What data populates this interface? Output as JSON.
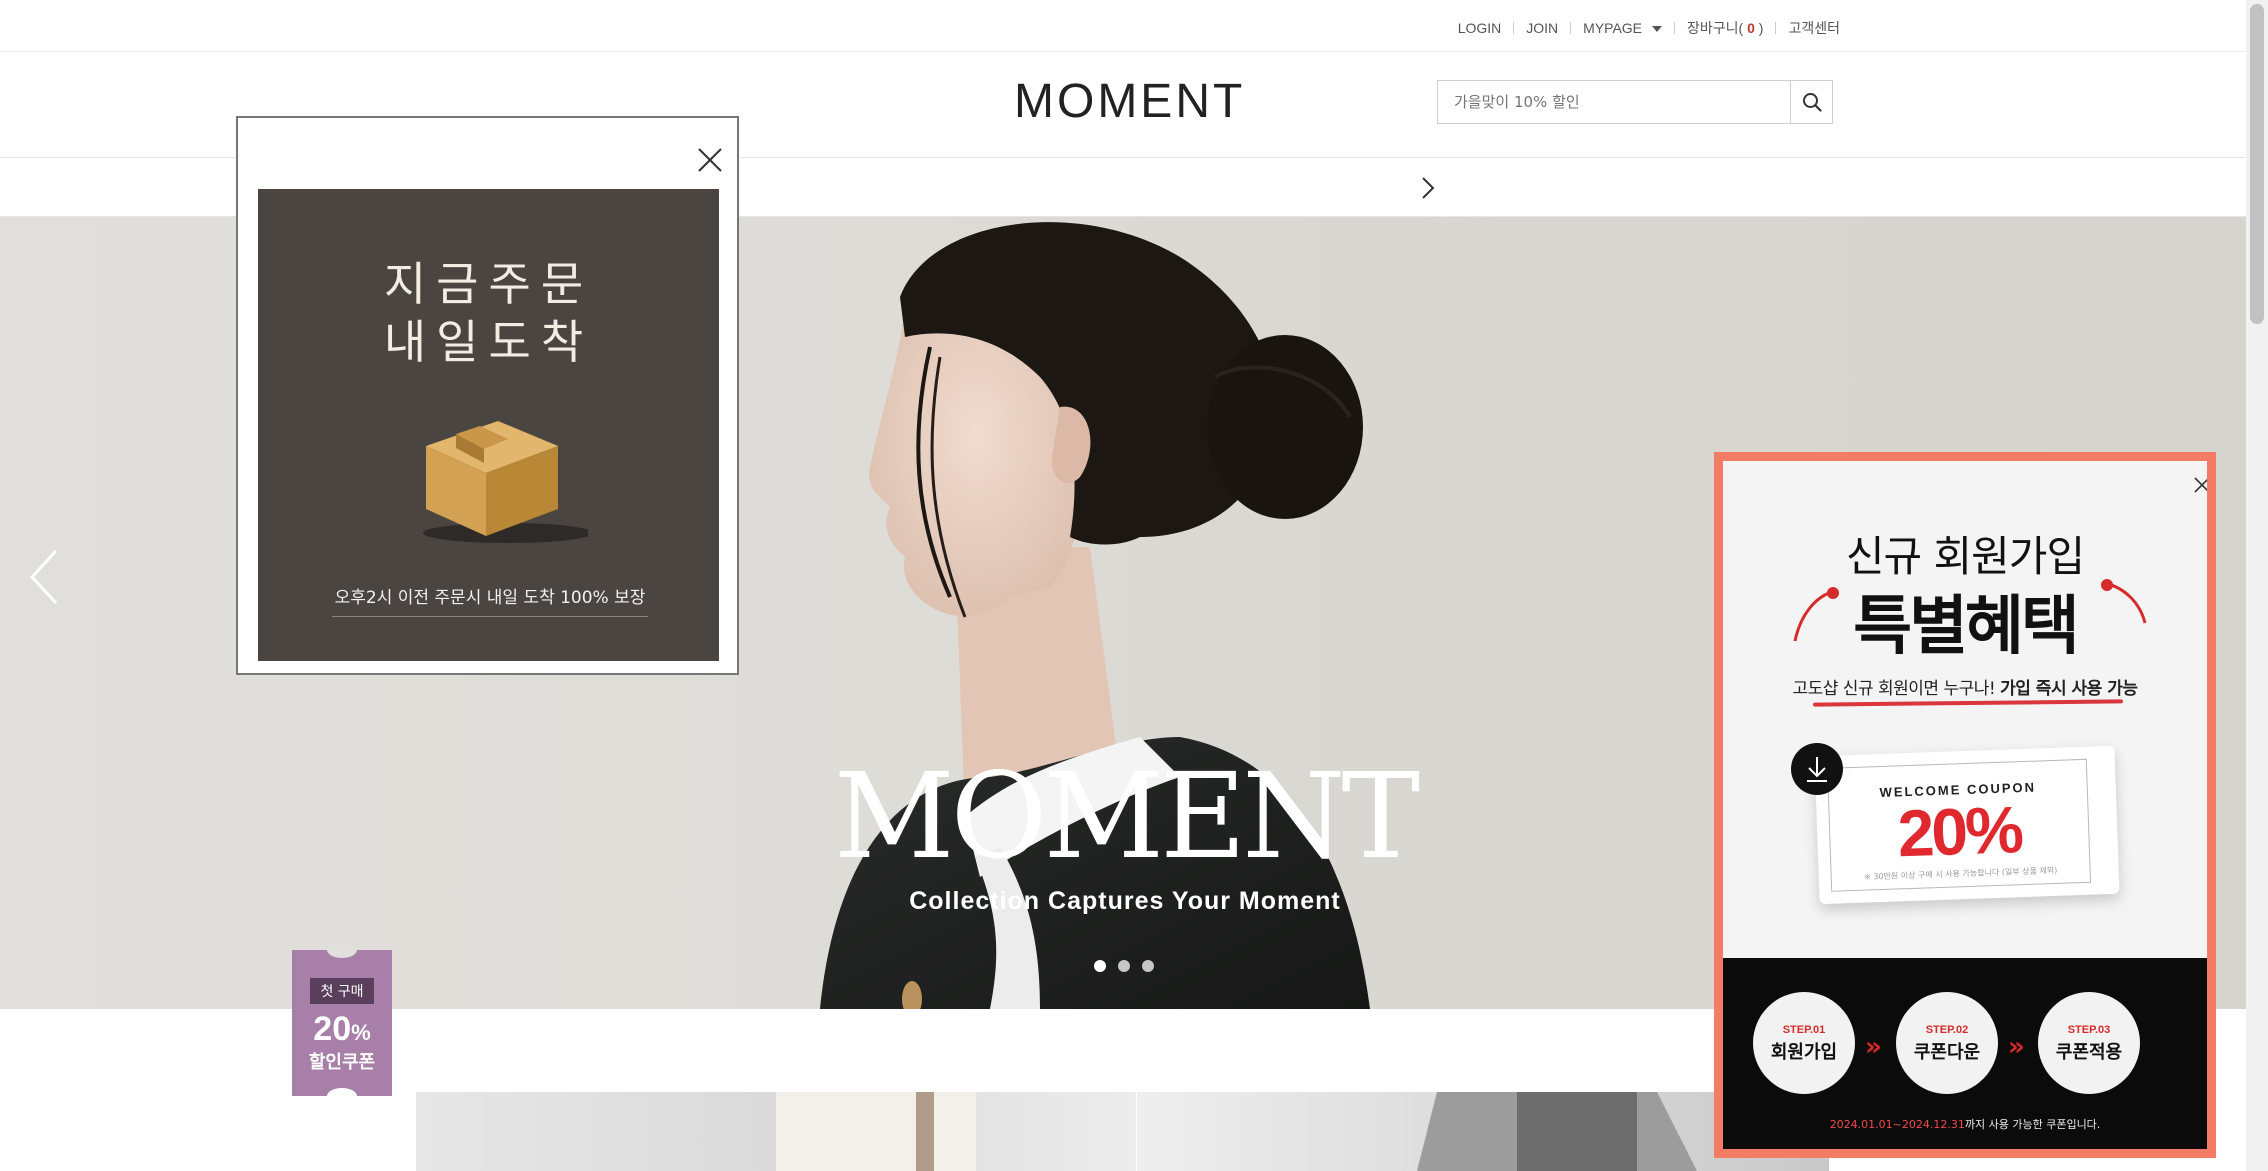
{
  "util_nav": {
    "login": "LOGIN",
    "join": "JOIN",
    "mypage": "MYPAGE",
    "cart_prefix": "장바구니(",
    "cart_count": "0",
    "cart_suffix": ")",
    "customer_center": "고객센터"
  },
  "header": {
    "logo": "MOMENT",
    "search_placeholder": "가을맞이 10% 할인"
  },
  "hero": {
    "title": "MOMENT",
    "subtitle": "Collection Captures Your Moment",
    "slide_count": 3,
    "active_slide": 1
  },
  "coupon_tab": {
    "tag": "첫 구매",
    "percent": "20",
    "percent_sign": "%",
    "label": "할인쿠폰",
    "color": "#a77fa8"
  },
  "popup_delivery": {
    "line1": "지금주문",
    "line2": "내일도착",
    "note": "오후2시 이전 주문시 내일 도착 100% 보장",
    "icon": "package-box-icon",
    "bg_color": "#4a4541"
  },
  "popup_signup": {
    "line1": "신규 회원가입",
    "line2": "특별혜택",
    "desc_plain": "고도샵 신규 회원이면 누구나! ",
    "desc_bold": "가입 즉시 사용 가능",
    "coupon_label": "WELCOME COUPON",
    "coupon_percent": "20%",
    "coupon_fine": "※ 30만원 이상 구매 시 사용 가능합니다 (일부 상품 제외)",
    "steps": [
      {
        "step": "STEP.01",
        "title": "회원가입"
      },
      {
        "step": "STEP.02",
        "title": "쿠폰다운"
      },
      {
        "step": "STEP.03",
        "title": "쿠폰적용"
      }
    ],
    "period_dates": "2024.01.01~2024.12.31",
    "period_text": "까지 사용 가능한 쿠폰입니다.",
    "border_color": "#f47c64"
  }
}
